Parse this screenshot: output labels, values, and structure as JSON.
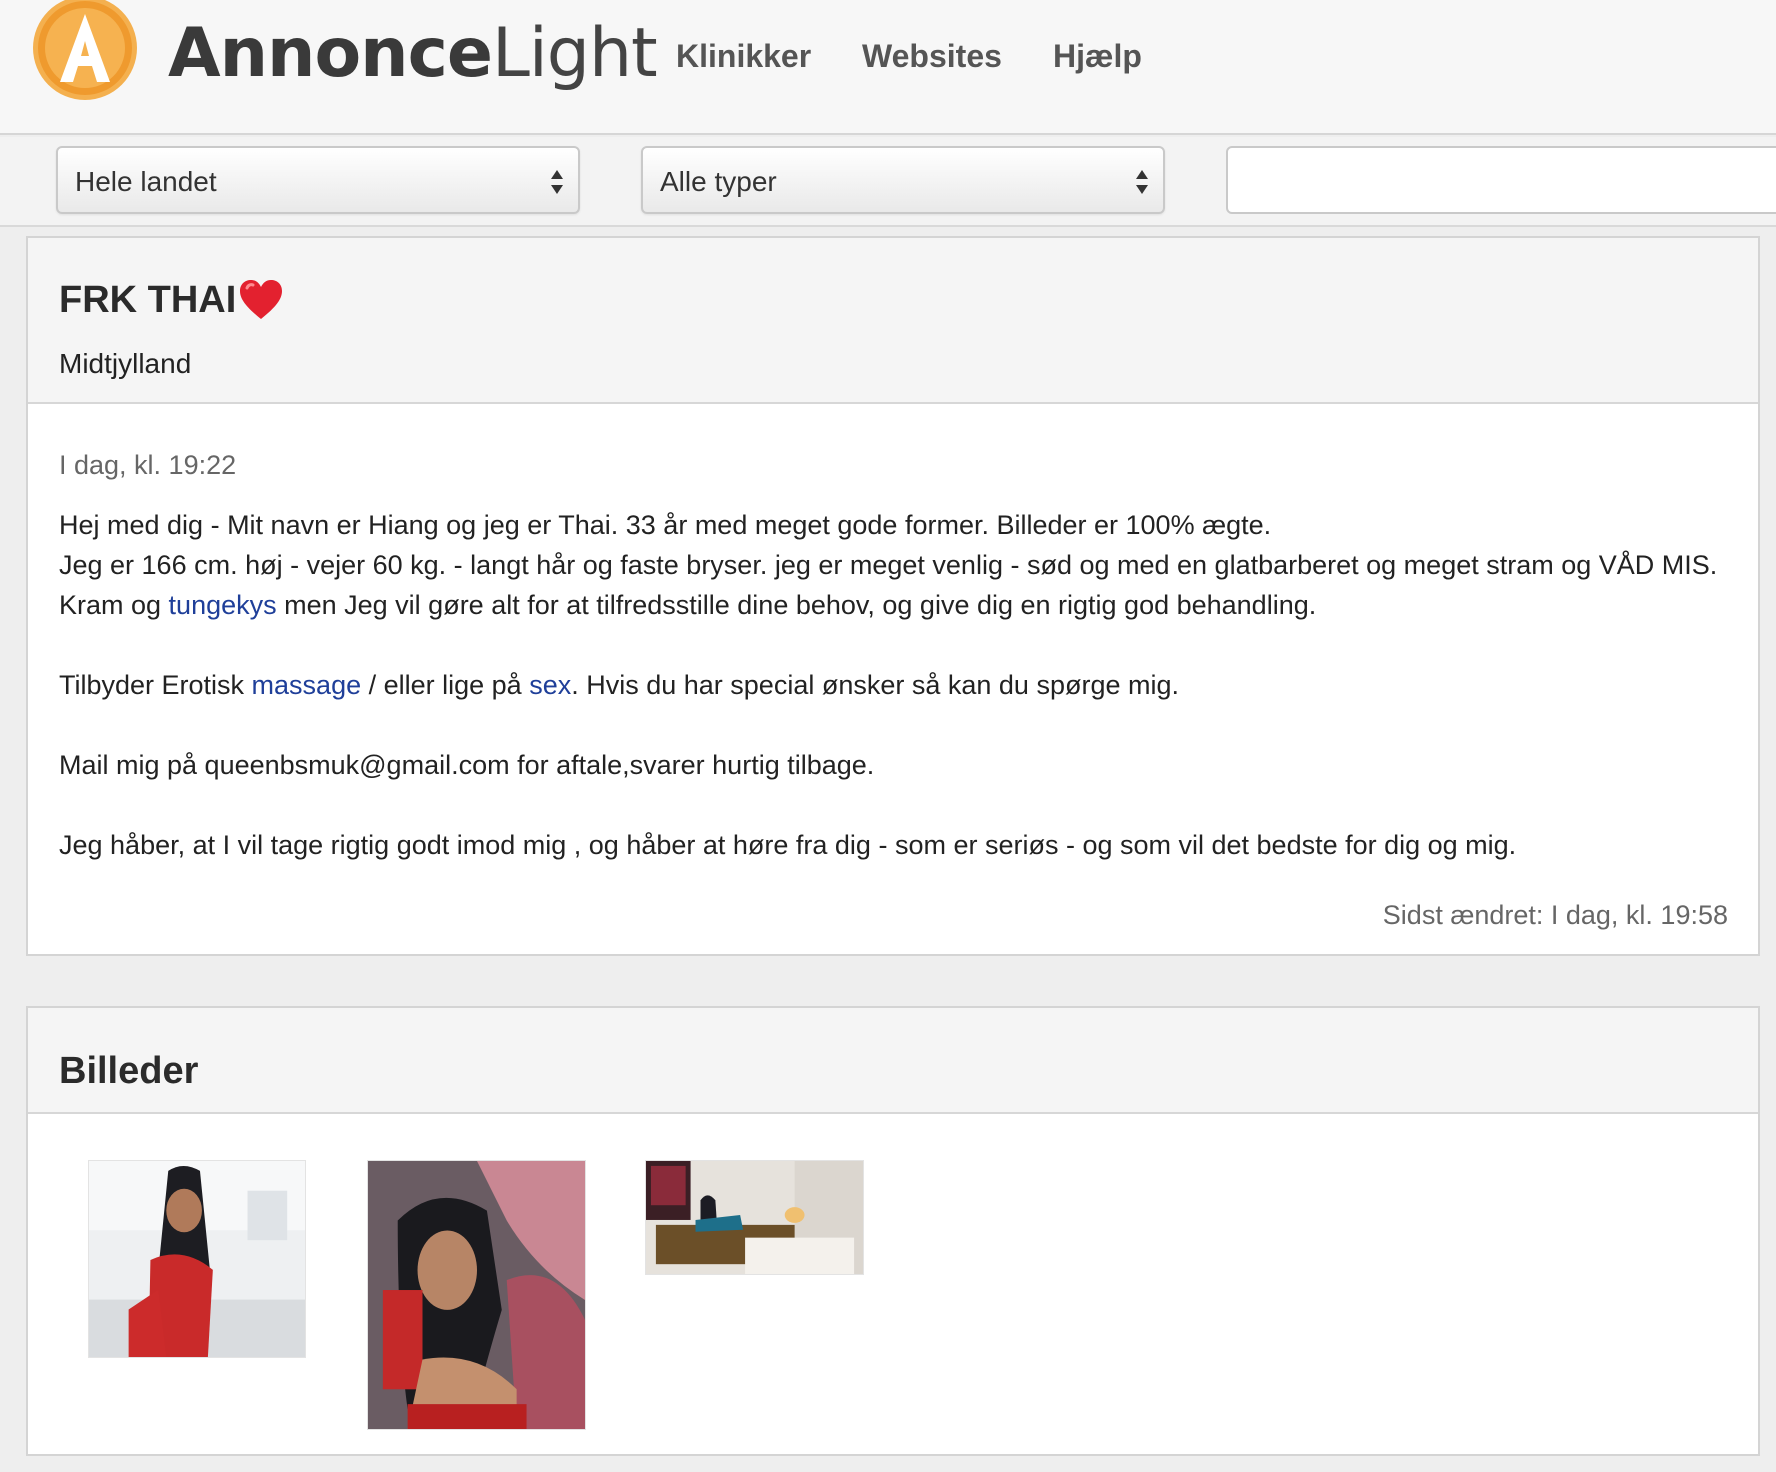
{
  "header": {
    "brand_bold": "Annonce",
    "brand_light": "Light",
    "nav": [
      "Klinikker",
      "Websites",
      "Hjælp"
    ]
  },
  "filters": {
    "region_select": "Hele landet",
    "type_select": "Alle typer",
    "search_value": ""
  },
  "ad": {
    "title": "FRK THAI",
    "title_icon": "heart-emoji-icon",
    "region": "Midtjylland",
    "posted": "I dag, kl. 19:22",
    "line1": "Hej med dig - Mit navn er Hiang og jeg er Thai. 33 år med meget gode former. Billeder er 100% ægte.",
    "line2a": "Jeg er 166 cm. høj - vejer 60 kg. - langt hår og faste bryser. jeg er meget venlig - sød og med en glatbarberet og meget stram og VÅD MIS. Kram og ",
    "link_tungekys": "tungekys",
    "line2b": " men Jeg vil gøre alt for at tilfredsstille dine behov, og give dig en rigtig god behandling.",
    "line3a": "Tilbyder Erotisk ",
    "link_massage": "massage",
    "line3b": " / eller lige på ",
    "link_sex": "sex",
    "line3c": ". Hvis du har special ønsker så kan du spørge mig.",
    "line4": "Mail mig på queenbsmuk@gmail.com for aftale,svarer hurtig tilbage.",
    "line5": "Jeg håber, at I vil tage rigtig godt imod mig , og håber at høre fra dig - som er seriøs - og som vil det bedste for dig og mig.",
    "modified": "Sidst ændret: I dag, kl. 19:58"
  },
  "pictures": {
    "title": "Billeder",
    "thumbnails": [
      "photo-thumbnail-1",
      "photo-thumbnail-2",
      "photo-thumbnail-3"
    ]
  },
  "colors": {
    "logo_orange": "#f2a13b",
    "link_blue": "#1f3f99",
    "heart_red": "#e3212f"
  }
}
